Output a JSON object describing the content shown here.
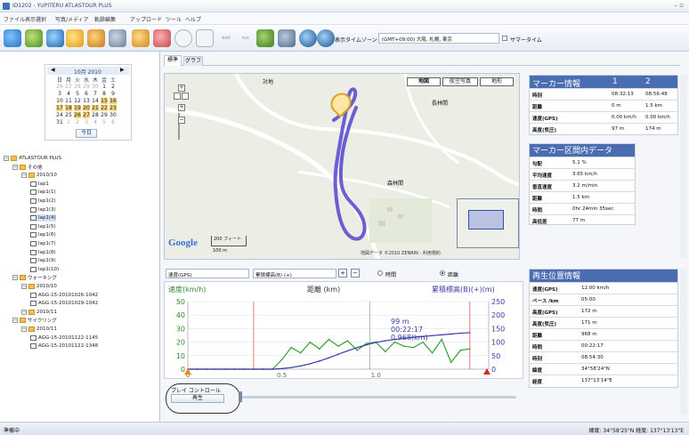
{
  "window": {
    "title": "ID1202 - YUPITERU ATLASTOUR PLUS",
    "controls": "– ▫"
  },
  "menu": [
    "ファイル",
    "表示選択",
    "写真/メディア",
    "軌跡編集",
    "アップロード",
    "ツール",
    "ヘルプ"
  ],
  "toolbar": {
    "display_timezone_label": "表示タイムゾーン",
    "timezone_value": "(GMT+09:00) 大阪, 札幌, 東京",
    "summertime_label": "サマータイム"
  },
  "calendar": {
    "month_label": "10月 2010",
    "weekdays": [
      "日",
      "月",
      "火",
      "水",
      "木",
      "金",
      "土"
    ],
    "weeks": [
      [
        "26",
        "27",
        "28",
        "29",
        "30",
        "1",
        "2"
      ],
      [
        "3",
        "4",
        "5",
        "6",
        "7",
        "8",
        "9"
      ],
      [
        "10",
        "11",
        "12",
        "13",
        "14",
        "15",
        "16"
      ],
      [
        "17",
        "18",
        "19",
        "20",
        "21",
        "22",
        "23"
      ],
      [
        "24",
        "25",
        "26",
        "27",
        "28",
        "29",
        "30"
      ],
      [
        "31",
        "1",
        "2",
        "3",
        "4",
        "5",
        "6"
      ]
    ],
    "today_button": "今日"
  },
  "tree": [
    {
      "label": "ATLASTOUR PLUS",
      "level": 0,
      "kind": "root"
    },
    {
      "label": "その他",
      "level": 1,
      "kind": "folder"
    },
    {
      "label": "2010/10",
      "level": 2,
      "kind": "folder"
    },
    {
      "label": "lap1",
      "level": 3,
      "kind": "file"
    },
    {
      "label": "lap1(1)",
      "level": 3,
      "kind": "file"
    },
    {
      "label": "lap1(2)",
      "level": 3,
      "kind": "file"
    },
    {
      "label": "lap1(3)",
      "level": 3,
      "kind": "file"
    },
    {
      "label": "lap1(4)",
      "level": 3,
      "kind": "file"
    },
    {
      "label": "lap1(5)",
      "level": 3,
      "kind": "file"
    },
    {
      "label": "lap1(6)",
      "level": 3,
      "kind": "file"
    },
    {
      "label": "lap1(7)",
      "level": 3,
      "kind": "file"
    },
    {
      "label": "lap1(8)",
      "level": 3,
      "kind": "file"
    },
    {
      "label": "lap1(9)",
      "level": 3,
      "kind": "file"
    },
    {
      "label": "lap1(10)",
      "level": 3,
      "kind": "file"
    },
    {
      "label": "ウォーキング",
      "level": 1,
      "kind": "folder"
    },
    {
      "label": "2010/10",
      "level": 2,
      "kind": "folder"
    },
    {
      "label": "AGG-15-20101026-1042",
      "level": 3,
      "kind": "file"
    },
    {
      "label": "AGG-15-20101029-1042",
      "level": 3,
      "kind": "file"
    },
    {
      "label": "2010/11",
      "level": 2,
      "kind": "folder"
    },
    {
      "label": "サイクリング",
      "level": 1,
      "kind": "folder"
    },
    {
      "label": "2010/11",
      "level": 2,
      "kind": "folder"
    },
    {
      "label": "AGG-15-20101122-1145",
      "level": 3,
      "kind": "file"
    },
    {
      "label": "AGG-15-20101122-1348",
      "level": 3,
      "kind": "file"
    }
  ],
  "tabs": [
    "標準",
    "グラフ"
  ],
  "map": {
    "type_buttons": [
      "地図",
      "航空写真",
      "地形"
    ],
    "place_labels": [
      "対地",
      "長林間",
      "森林間"
    ],
    "scale_labels": [
      "200 フィート",
      "100 m"
    ],
    "attribution": "地図データ ©2010 ZENRIN - 利用規約",
    "google_logo": "Google"
  },
  "marker_info": {
    "title": "マーカー情報",
    "cols": [
      "1",
      "2"
    ],
    "rows": [
      {
        "label": "時刻",
        "v1": "08:32:13",
        "v2": "08:56:48"
      },
      {
        "label": "距離",
        "v1": "0 m",
        "v2": "1.5 km"
      },
      {
        "label": "速度(GPS)",
        "v1": "0.00 km/h",
        "v2": "0.00 km/h"
      },
      {
        "label": "高度(気圧)",
        "v1": "97 m",
        "v2": "174 m"
      }
    ]
  },
  "section_data": {
    "title": "マーカー区間内データ",
    "rows": [
      {
        "label": "勾配",
        "value": "5.1 %"
      },
      {
        "label": "平均速度",
        "value": "3.65 km/h"
      },
      {
        "label": "垂直速度",
        "value": "3.2 m/min"
      },
      {
        "label": "距離",
        "value": "1.5 km"
      },
      {
        "label": "時間",
        "value": "0hr 24min 35sec"
      },
      {
        "label": "高低差",
        "value": "77 m"
      }
    ]
  },
  "graph_controls": {
    "select1": "速度(GPS)",
    "select2": "累積標高(B) (+)",
    "plus": "+",
    "minus": "−",
    "radio_time": "時間",
    "radio_distance": "距離"
  },
  "chart": {
    "left_label": "速度(km/h)",
    "center_label": "距離 (km)",
    "right_label": "累積標高(B)(+)(m)",
    "left_ticks": [
      "50",
      "40",
      "30",
      "20",
      "10",
      "0"
    ],
    "right_ticks": [
      "250",
      "200",
      "150",
      "100",
      "50",
      "0"
    ],
    "x_ticks": [
      "0",
      "0.5",
      "1.0"
    ],
    "annotation": [
      "99 m",
      "00:22:17",
      "0.968(km)"
    ]
  },
  "chart_data": {
    "type": "line",
    "x": [
      0,
      0.05,
      0.1,
      0.15,
      0.2,
      0.25,
      0.3,
      0.35,
      0.4,
      0.45,
      0.5,
      0.55,
      0.6,
      0.65,
      0.7,
      0.75,
      0.8,
      0.85,
      0.9,
      0.95,
      1.0,
      1.05,
      1.1,
      1.15,
      1.2,
      1.25,
      1.3,
      1.35,
      1.4,
      1.45,
      1.5
    ],
    "series": [
      {
        "name": "速度(km/h)",
        "axis": "left",
        "color": "#33a033",
        "values": [
          0,
          0,
          0,
          0,
          0,
          0,
          0,
          0,
          0,
          0,
          7,
          16,
          12,
          20,
          15,
          22,
          17,
          21,
          14,
          19,
          20,
          13,
          20,
          17,
          16,
          20,
          12,
          22,
          5,
          14,
          15
        ]
      },
      {
        "name": "累積標高(B)(+)(m)",
        "axis": "right",
        "color": "#3a3aa8",
        "values": [
          0,
          0,
          0,
          0,
          0,
          0,
          0,
          0,
          0,
          0,
          2,
          6,
          12,
          20,
          30,
          42,
          55,
          68,
          80,
          90,
          99,
          105,
          110,
          114,
          118,
          121,
          124,
          127,
          130,
          133,
          135
        ]
      }
    ],
    "xlabel": "距離 (km)",
    "ylabel": "速度(km/h)",
    "ylabel_right": "累積標高(B)(+)(m)",
    "xlim": [
      0,
      1.6
    ],
    "ylim": [
      0,
      50
    ],
    "ylim_right": [
      0,
      250
    ]
  },
  "play_control": {
    "title": "プレイ コントロール",
    "button": "再生"
  },
  "playback_info": {
    "title": "再生位置情報",
    "rows": [
      {
        "label": "速度(GPS)",
        "value": "12.00 km/h"
      },
      {
        "label": "ペース /km",
        "value": "05:00"
      },
      {
        "label": "高度(GPS)",
        "value": "172 m"
      },
      {
        "label": "高度(気圧)",
        "value": "171 m"
      },
      {
        "label": "距離",
        "value": "968 m"
      },
      {
        "label": "時間",
        "value": "00:22:17"
      },
      {
        "label": "時刻",
        "value": "08:54:30"
      },
      {
        "label": "緯度",
        "value": "34°58'24\"N"
      },
      {
        "label": "経度",
        "value": "137°13'14\"E"
      }
    ]
  },
  "status": {
    "left": "準備中",
    "right": "緯度: 34°58'25\"N  経度: 137°13'13\"E"
  }
}
